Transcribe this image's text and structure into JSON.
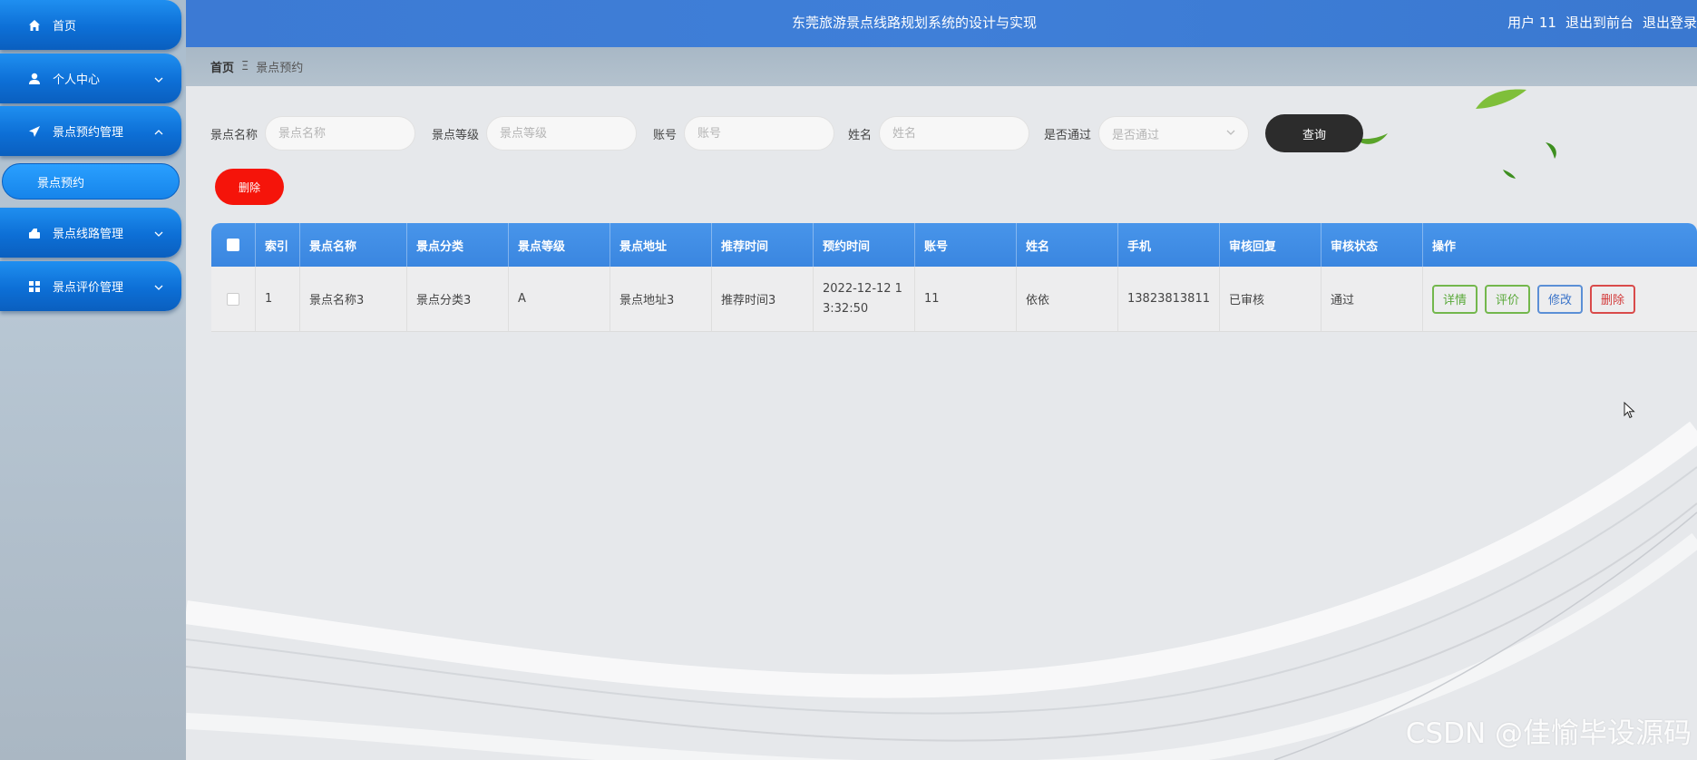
{
  "sidebar": {
    "items": [
      {
        "label": "首页",
        "icon": "home-icon"
      },
      {
        "label": "个人中心",
        "icon": "user-icon"
      },
      {
        "label": "景点预约管理",
        "icon": "send-icon"
      },
      {
        "label": "景点线路管理",
        "icon": "cart-icon"
      },
      {
        "label": "景点评价管理",
        "icon": "grid-icon"
      }
    ],
    "sub_items": [
      {
        "label": "景点预约"
      }
    ]
  },
  "header": {
    "title": "东莞旅游景点线路规划系统的设计与实现",
    "user": "用户 11",
    "back_front": "退出到前台",
    "logout": "退出登录"
  },
  "breadcrumb": {
    "home": "首页",
    "separator": "Ξ",
    "current": "景点预约"
  },
  "filters": {
    "name_label": "景点名称",
    "name_placeholder": "景点名称",
    "level_label": "景点等级",
    "level_placeholder": "景点等级",
    "account_label": "账号",
    "account_placeholder": "账号",
    "person_label": "姓名",
    "person_placeholder": "姓名",
    "passed_label": "是否通过",
    "passed_value": "是否通过",
    "query_label": "查询"
  },
  "actions": {
    "delete_label": "删除"
  },
  "table": {
    "columns": [
      "索引",
      "景点名称",
      "景点分类",
      "景点等级",
      "景点地址",
      "推荐时间",
      "预约时间",
      "账号",
      "姓名",
      "手机",
      "审核回复",
      "审核状态",
      "操作"
    ],
    "rows": [
      {
        "index": "1",
        "name": "景点名称3",
        "category": "景点分类3",
        "level": "A",
        "address": "景点地址3",
        "recommend_time": "推荐时间3",
        "booking_time": "2022-12-12 13:32:50",
        "account": "11",
        "person": "依依",
        "phone": "13823813811",
        "reply": "已审核",
        "status": "通过"
      }
    ],
    "row_actions": {
      "detail": "详情",
      "rate": "评价",
      "edit": "修改",
      "delete": "删除"
    }
  },
  "watermark": "CSDN @佳愉毕设源码",
  "colors": {
    "accent": "#3c7ad4",
    "delete": "#f5140a",
    "query": "#2c2c2c"
  }
}
